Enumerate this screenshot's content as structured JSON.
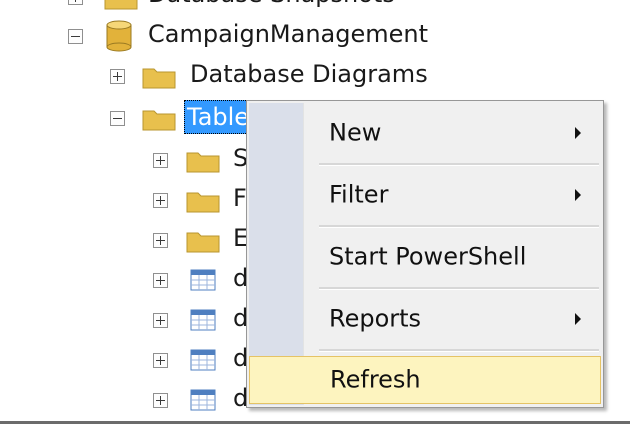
{
  "tree": {
    "partial_top_label": "Database Snapshots",
    "database_label": "CampaignManagement",
    "database_diagrams_label": "Database Diagrams",
    "tables_label": "Tables",
    "children": [
      {
        "label": "S",
        "kind": "folder"
      },
      {
        "label": "F",
        "kind": "folder"
      },
      {
        "label": "E",
        "kind": "folder"
      },
      {
        "label": "d",
        "kind": "table"
      },
      {
        "label": "d",
        "kind": "table"
      },
      {
        "label": "d",
        "kind": "table"
      },
      {
        "label": "d",
        "kind": "table"
      }
    ]
  },
  "context_menu": {
    "items": [
      {
        "label": "New",
        "has_submenu": true
      },
      {
        "label": "Filter",
        "has_submenu": true
      },
      {
        "label": "Start PowerShell",
        "has_submenu": false
      },
      {
        "label": "Reports",
        "has_submenu": true
      },
      {
        "label": "Refresh",
        "has_submenu": false,
        "highlighted": true
      }
    ]
  },
  "colors": {
    "selection": "#3399ff",
    "menu_background": "#f0f0f0",
    "menu_gutter": "#dadfea",
    "highlight_fill": "#fdf4bf",
    "highlight_border": "#e5c365",
    "folder": "#e8c04d"
  },
  "icons": {
    "database": "database-cylinder-icon",
    "folder": "folder-icon",
    "table": "table-icon",
    "expand": "plus-expander-icon",
    "collapse": "minus-expander-icon",
    "submenu": "submenu-arrow-icon"
  }
}
